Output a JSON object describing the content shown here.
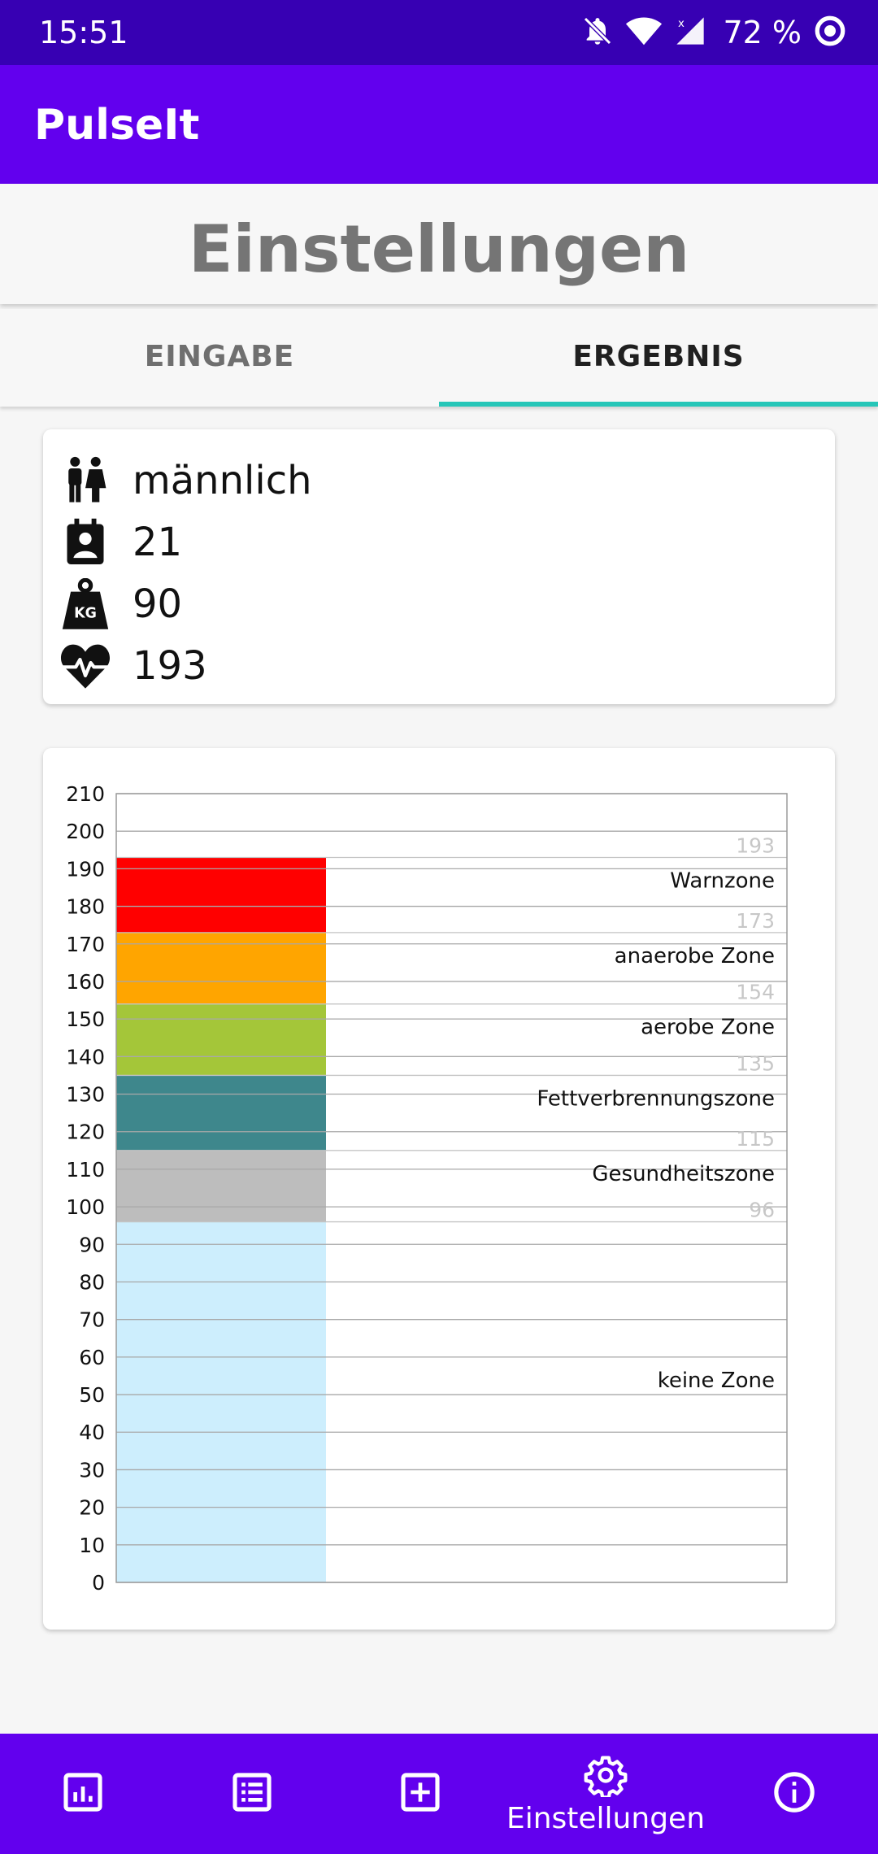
{
  "status": {
    "time": "15:51",
    "battery": "72 %"
  },
  "app": {
    "title": "PulseIt"
  },
  "page": {
    "title": "Einstellungen"
  },
  "tabs": [
    {
      "label": "EINGABE"
    },
    {
      "label": "ERGEBNIS"
    }
  ],
  "profile": {
    "gender": "männlich",
    "age": "21",
    "weight": "90",
    "max_hr": "193",
    "weight_icon_text": "KG"
  },
  "chart_data": {
    "type": "bar",
    "title": "",
    "xlabel": "",
    "ylabel": "",
    "ylim": [
      0,
      210
    ],
    "yticks": [
      0,
      10,
      20,
      30,
      40,
      50,
      60,
      70,
      80,
      90,
      100,
      110,
      120,
      130,
      140,
      150,
      160,
      170,
      180,
      190,
      200,
      210
    ],
    "grid": true,
    "series": [
      {
        "name": "keine Zone",
        "from": 0,
        "to": 96,
        "color": "#cdeefd"
      },
      {
        "name": "Gesundheitszone",
        "from": 96,
        "to": 115,
        "color": "#bdbdbd"
      },
      {
        "name": "Fettverbrennungszone",
        "from": 115,
        "to": 135,
        "color": "#3e878c"
      },
      {
        "name": "aerobe Zone",
        "from": 135,
        "to": 154,
        "color": "#a4c639"
      },
      {
        "name": "anaerobe Zone",
        "from": 154,
        "to": 173,
        "color": "#ffa500"
      },
      {
        "name": "Warnzone",
        "from": 173,
        "to": 193,
        "color": "#ff0000"
      }
    ],
    "boundary_labels": [
      96,
      115,
      135,
      154,
      173,
      193
    ]
  },
  "nav": [
    {
      "icon": "statistics-icon",
      "label": ""
    },
    {
      "icon": "list-icon",
      "label": ""
    },
    {
      "icon": "add-box-icon",
      "label": ""
    },
    {
      "icon": "settings-icon",
      "label": "Einstellungen"
    },
    {
      "icon": "info-icon",
      "label": ""
    }
  ],
  "colors": {
    "statusbar": "#3700b3",
    "primary": "#6200ee",
    "tab_indicator": "#26c6b8"
  }
}
